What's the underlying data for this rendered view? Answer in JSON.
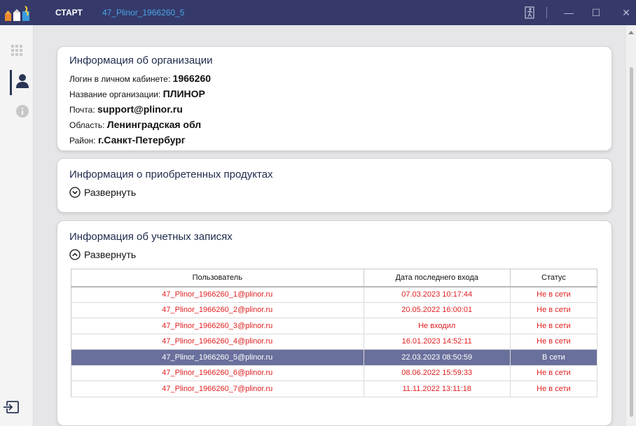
{
  "window": {
    "title": "СТАРТ",
    "subtitle": "47_Plinor_1966260_5",
    "icons": [
      "app-logo",
      "exit-icon",
      "minimize-icon",
      "maximize-icon",
      "close-icon"
    ],
    "min_glyph": "—",
    "max_glyph": "☐",
    "close_glyph": "✕"
  },
  "sidebar": {
    "items": [
      {
        "name": "apps-grid-icon",
        "active": false
      },
      {
        "name": "user-icon",
        "active": true
      },
      {
        "name": "info-icon",
        "active": false
      }
    ],
    "bottom": {
      "name": "logout-icon"
    }
  },
  "org": {
    "title": "Информация об организации",
    "login_label": "Логин в личном кабинете:",
    "login_value": "1966260",
    "name_label": "Название организации:",
    "name_value": "ПЛИНОР",
    "email_label": "Почта:",
    "email_value": "support@plinor.ru",
    "region_label": "Область:",
    "region_value": "Ленинградская обл",
    "district_label": "Район:",
    "district_value": "г.Санкт-Петербург"
  },
  "products": {
    "title": "Информация о приобретенных продуктах",
    "expand_label": "Развернуть"
  },
  "accounts": {
    "title": "Информация об учетных записях",
    "expand_label": "Развернуть",
    "columns": [
      "Пользователь",
      "Дата последнего входа",
      "Статус"
    ],
    "rows": [
      {
        "user": "47_Plinor_1966260_1@plinor.ru",
        "last_login": "07.03.2023 10:17:44",
        "status": "Не в сети"
      },
      {
        "user": "47_Plinor_1966260_2@plinor.ru",
        "last_login": "20.05.2022 16:00:01",
        "status": "Не в сети"
      },
      {
        "user": "47_Plinor_1966260_3@plinor.ru",
        "last_login": "Не входил",
        "status": "Не в сети"
      },
      {
        "user": "47_Plinor_1966260_4@plinor.ru",
        "last_login": "16.01.2023 14:52:11",
        "status": "Не в сети"
      },
      {
        "user": "47_Plinor_1966260_5@plinor.ru",
        "last_login": "22.03.2023 08:50:59",
        "status": "В сети"
      },
      {
        "user": "47_Plinor_1966260_6@plinor.ru",
        "last_login": "08.06.2022 15:59:33",
        "status": "Не в сети"
      },
      {
        "user": "47_Plinor_1966260_7@plinor.ru",
        "last_login": "11.11.2022 13:11:18",
        "status": "Не в сети"
      }
    ],
    "selected_row": 4
  },
  "colors": {
    "titlebar": "#353a6a",
    "offline_text": "#e02020",
    "selected_row": "#6a709c",
    "subtitle": "#4ba6e6"
  }
}
